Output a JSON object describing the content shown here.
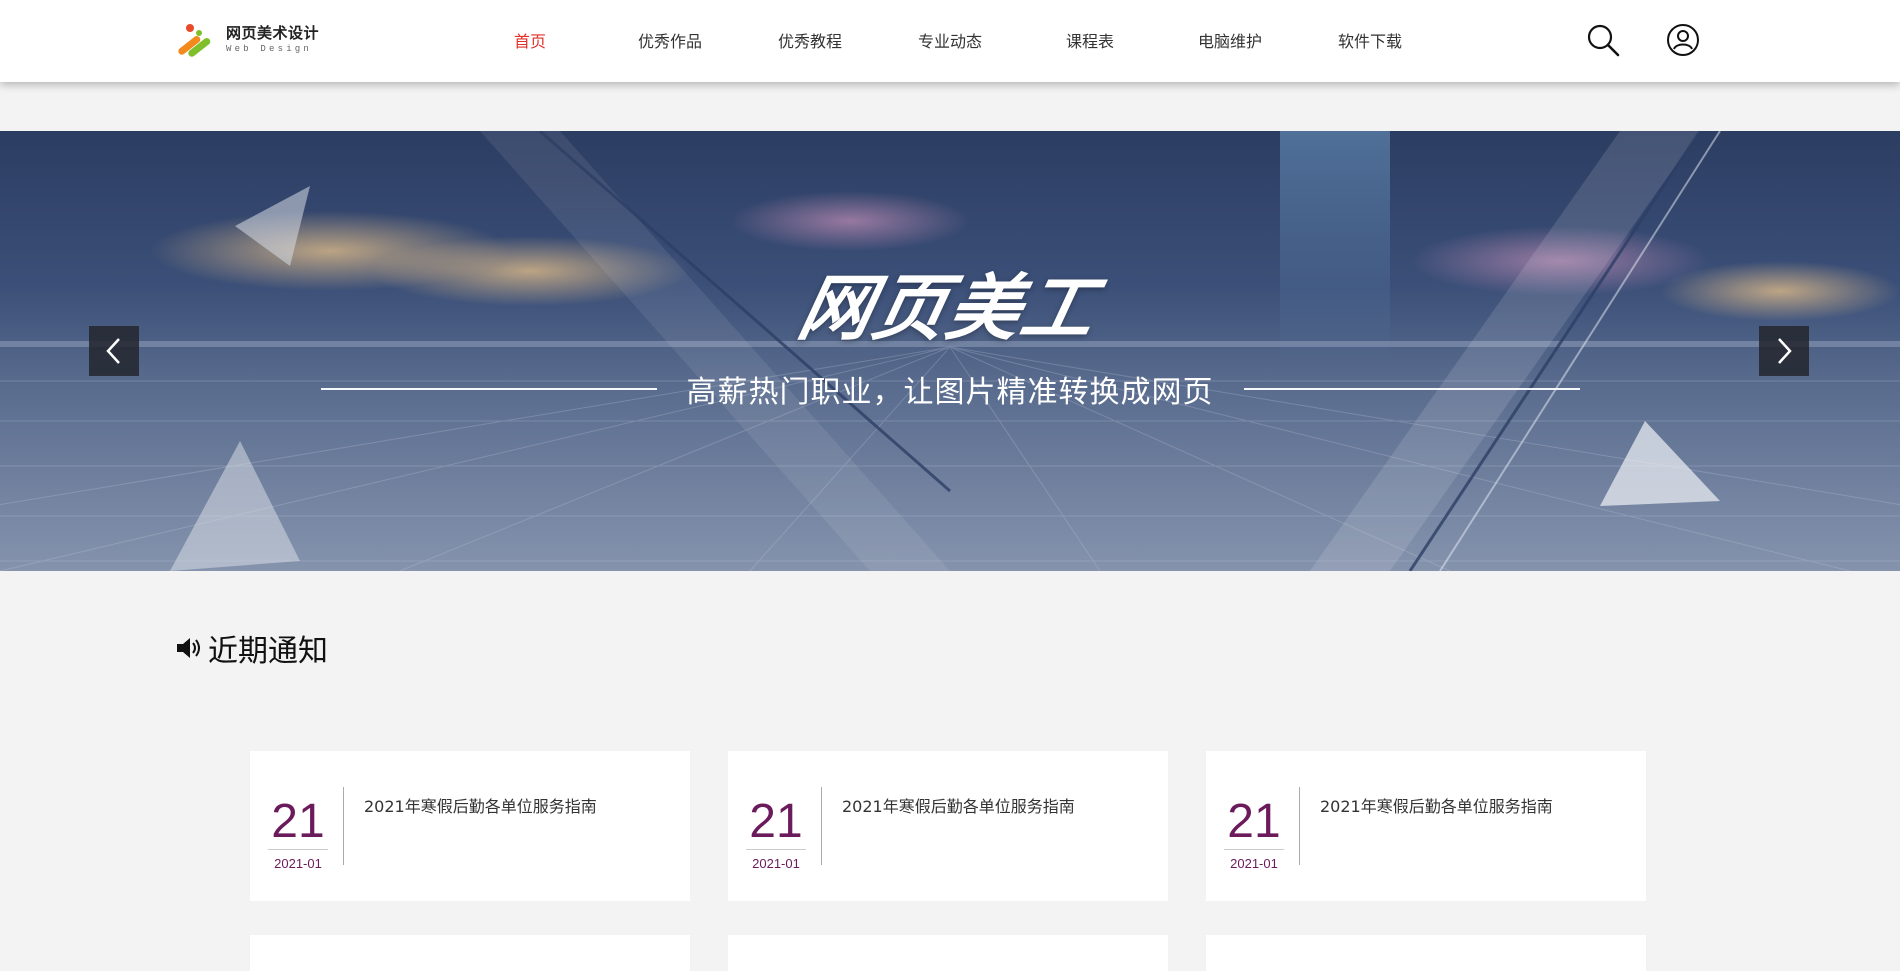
{
  "brand": {
    "name_cn": "网页美术设计",
    "name_en": "Web Design"
  },
  "nav": {
    "items": [
      {
        "label": "首页",
        "active": true
      },
      {
        "label": "优秀作品",
        "active": false
      },
      {
        "label": "优秀教程",
        "active": false
      },
      {
        "label": "专业动态",
        "active": false
      },
      {
        "label": "课程表",
        "active": false
      },
      {
        "label": "电脑维护",
        "active": false
      },
      {
        "label": "软件下载",
        "active": false
      }
    ],
    "active_color": "#e0312a"
  },
  "header_icons": {
    "search": "search-icon",
    "user": "user-icon"
  },
  "banner": {
    "title": "网页美工",
    "subtitle": "高薪热门职业，让图片精准转换成网页",
    "prev": "chevron-left-icon",
    "next": "chevron-right-icon"
  },
  "notice": {
    "title": "近期通知",
    "icon": "speaker-icon",
    "date_color": "#6b1b5b",
    "cards": [
      {
        "day": "21",
        "month": "2021-01",
        "title": "2021年寒假后勤各单位服务指南"
      },
      {
        "day": "21",
        "month": "2021-01",
        "title": "2021年寒假后勤各单位服务指南"
      },
      {
        "day": "21",
        "month": "2021-01",
        "title": "2021年寒假后勤各单位服务指南"
      }
    ]
  }
}
